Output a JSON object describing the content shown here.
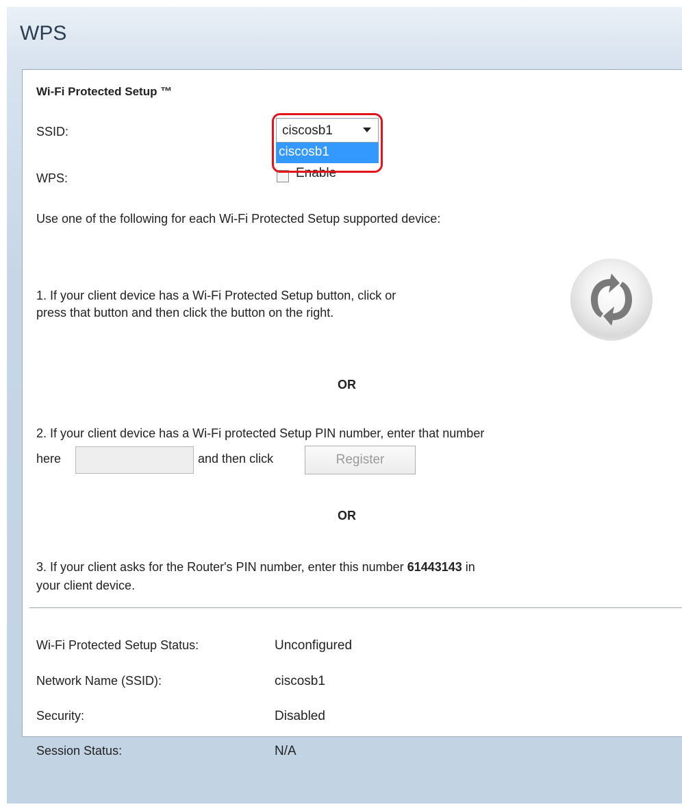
{
  "page": {
    "title": "WPS"
  },
  "wps_section": {
    "title": "Wi-Fi Protected Setup ™",
    "ssid_label": "SSID:",
    "ssid_selected": "ciscosb1",
    "ssid_options": [
      "ciscosb1"
    ],
    "wps_label": "WPS:",
    "enable_label": "Enable",
    "enable_checked": false,
    "instructions": "Use one of the following for each Wi-Fi Protected Setup supported device:"
  },
  "step1": {
    "line1": "1. If your client device has a Wi-Fi Protected Setup button, click or",
    "line2": "press that button and then click the button on the right.",
    "icon": "wps-push-button-icon"
  },
  "or_label": "OR",
  "step2": {
    "line1": "2. If your client device has a Wi-Fi protected Setup PIN number, enter that number",
    "prefix": "here",
    "pin_value": "",
    "suffix": "and then click",
    "register_label": "Register"
  },
  "step3": {
    "line1_before": "3. If your client asks for the Router's PIN number, enter this number ",
    "pin": "61443143",
    "line1_after": " in",
    "line2": "your client device."
  },
  "status": {
    "wps_status_label": "Wi-Fi Protected Setup Status:",
    "wps_status_value": "Unconfigured",
    "network_name_label": "Network Name (SSID):",
    "network_name_value": "ciscosb1",
    "security_label": "Security:",
    "security_value": "Disabled",
    "session_status_label": "Session Status:",
    "session_status_value": "N/A"
  },
  "colors": {
    "highlight": "#e3131c",
    "dropdown_selected_bg": "#3399ff",
    "background_gradient": "#c6d6e6"
  }
}
